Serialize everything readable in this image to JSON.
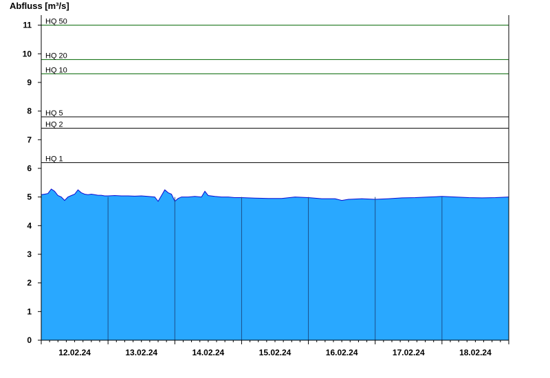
{
  "chart_data": {
    "type": "area",
    "ylabel": "Abfluss [m³/s]",
    "ylim": [
      0,
      11.35
    ],
    "yticks": [
      0,
      1,
      2,
      3,
      4,
      5,
      6,
      7,
      8,
      9,
      10,
      11
    ],
    "days": [
      "12.02.24",
      "13.02.24",
      "14.02.24",
      "15.02.24",
      "16.02.24",
      "17.02.24",
      "18.02.24"
    ],
    "thresholds": [
      {
        "label": "HQ 50",
        "value": 11.0,
        "color": "#006400"
      },
      {
        "label": "HQ 20",
        "value": 9.8,
        "color": "#006400"
      },
      {
        "label": "HQ 10",
        "value": 9.3,
        "color": "#006400"
      },
      {
        "label": "HQ 5",
        "value": 7.8,
        "color": "#000000"
      },
      {
        "label": "HQ 2",
        "value": 7.4,
        "color": "#000000"
      },
      {
        "label": "HQ 1",
        "value": 6.2,
        "color": "#000000"
      }
    ],
    "series": [
      {
        "x": [
          0,
          0.05,
          0.1,
          0.15,
          0.2,
          0.25,
          0.3,
          0.35,
          0.4,
          0.45,
          0.5,
          0.55,
          0.6,
          0.65,
          0.7,
          0.75,
          0.8,
          0.85,
          0.9,
          0.95,
          1.0,
          1.1,
          1.2,
          1.3,
          1.4,
          1.5,
          1.6,
          1.7,
          1.75,
          1.8,
          1.85,
          1.9,
          1.95,
          2.0,
          2.05,
          2.1,
          2.2,
          2.3,
          2.4,
          2.45,
          2.5,
          2.6,
          2.7,
          2.8,
          2.9,
          3.0,
          3.2,
          3.4,
          3.6,
          3.8,
          4.0,
          4.2,
          4.4,
          4.5,
          4.6,
          4.8,
          5.0,
          5.2,
          5.4,
          5.6,
          5.8,
          6.0,
          6.2,
          6.4,
          6.6,
          6.8,
          7.0
        ],
        "values": [
          5.08,
          5.1,
          5.12,
          5.28,
          5.2,
          5.05,
          5.0,
          4.88,
          5.0,
          5.05,
          5.1,
          5.25,
          5.15,
          5.1,
          5.08,
          5.1,
          5.08,
          5.06,
          5.06,
          5.04,
          5.04,
          5.05,
          5.04,
          5.04,
          5.03,
          5.04,
          5.02,
          5.0,
          4.85,
          5.05,
          5.25,
          5.15,
          5.1,
          4.85,
          4.95,
          5.0,
          5.0,
          5.02,
          5.0,
          5.2,
          5.05,
          5.02,
          5.0,
          5.0,
          4.98,
          4.98,
          4.96,
          4.95,
          4.95,
          5.0,
          4.98,
          4.94,
          4.94,
          4.88,
          4.92,
          4.94,
          4.92,
          4.94,
          4.97,
          4.98,
          5.0,
          5.02,
          5.0,
          4.98,
          4.97,
          4.98,
          5.0
        ]
      }
    ]
  },
  "colors": {
    "fill": "#29a8ff",
    "outline": "#0a0ad2",
    "day_separator": "#1b4f8a",
    "axis": "#000000"
  }
}
